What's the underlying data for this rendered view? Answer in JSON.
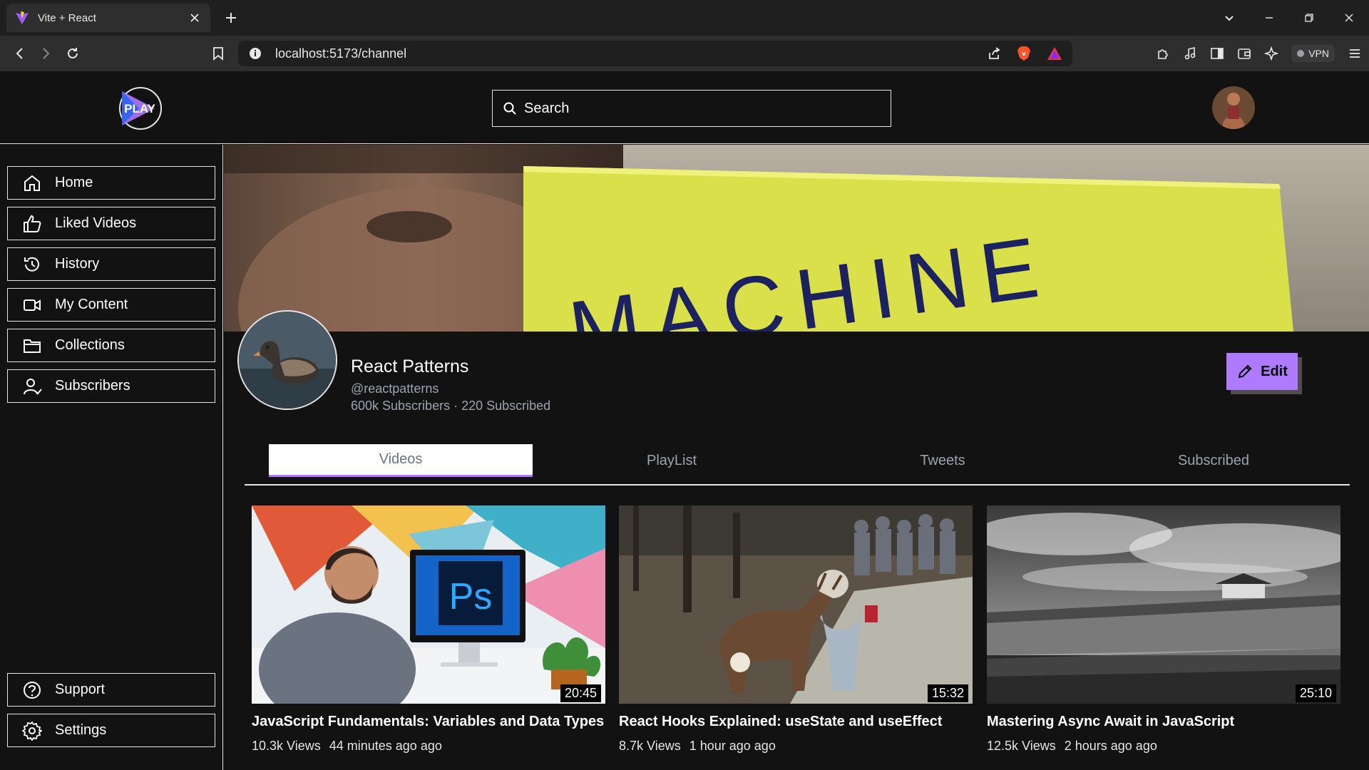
{
  "browser": {
    "tab_title": "Vite + React",
    "url": "localhost:5173/channel",
    "vpn_label": "VPN"
  },
  "header": {
    "logo_text": "PLAY",
    "search_placeholder": "Search"
  },
  "sidebar": {
    "items": [
      {
        "label": "Home",
        "icon": "home-icon"
      },
      {
        "label": "Liked Videos",
        "icon": "thumbs-up-icon"
      },
      {
        "label": "History",
        "icon": "history-icon"
      },
      {
        "label": "My Content",
        "icon": "video-camera-icon"
      },
      {
        "label": "Collections",
        "icon": "folder-icon"
      },
      {
        "label": "Subscribers",
        "icon": "user-check-icon"
      }
    ],
    "bottom_items": [
      {
        "label": "Support",
        "icon": "help-circle-icon"
      },
      {
        "label": "Settings",
        "icon": "gear-icon"
      }
    ]
  },
  "channel": {
    "cover_text": "MACHINE",
    "name": "React Patterns",
    "handle": "@reactpatterns",
    "stats": "600k Subscribers · 220 Subscribed",
    "edit_label": "Edit"
  },
  "tabs": [
    {
      "label": "Videos",
      "active": true
    },
    {
      "label": "PlayList",
      "active": false
    },
    {
      "label": "Tweets",
      "active": false
    },
    {
      "label": "Subscribed",
      "active": false
    }
  ],
  "videos": [
    {
      "title": "JavaScript Fundamentals: Variables and Data Types",
      "views": "10.3k Views",
      "time": "44 minutes ago ago",
      "duration": "20:45"
    },
    {
      "title": "React Hooks Explained: useState and useEffect",
      "views": "8.7k Views",
      "time": "1 hour ago ago",
      "duration": "15:32"
    },
    {
      "title": "Mastering Async Await in JavaScript",
      "views": "12.5k Views",
      "time": "2 hours ago ago",
      "duration": "25:10"
    }
  ],
  "colors": {
    "accent": "#ae7aff",
    "background": "#121212",
    "border": "#e5e5e5"
  }
}
